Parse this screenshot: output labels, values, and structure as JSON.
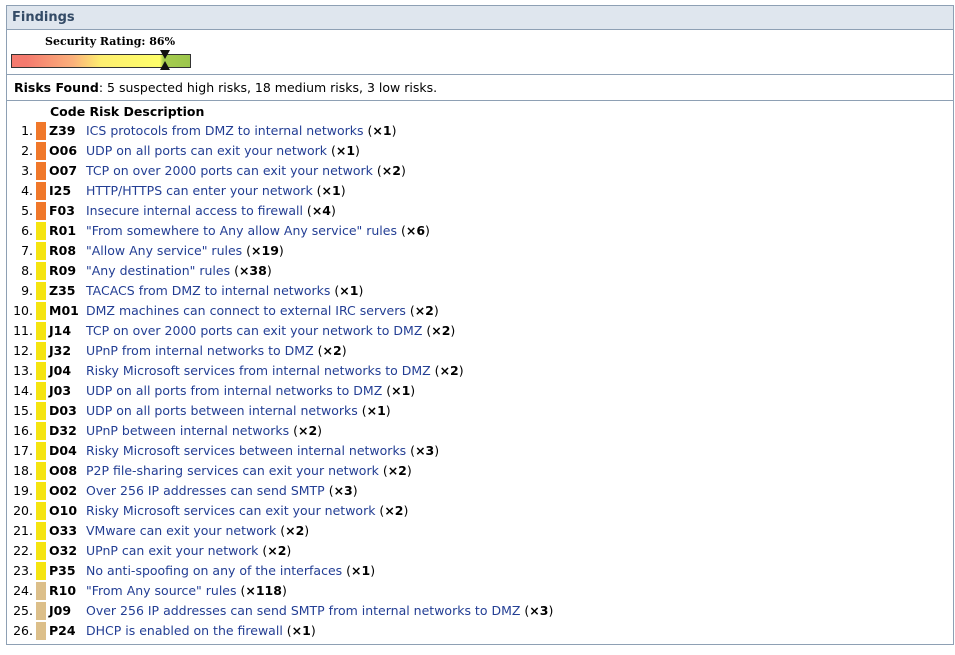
{
  "header": {
    "title": "Findings"
  },
  "rating": {
    "label": "Security Rating: 86%",
    "value_percent": 86
  },
  "summary": {
    "label": "Risks Found",
    "text": ": 5 suspected high risks, 18 medium risks, 3 low risks."
  },
  "table": {
    "header": "Code Risk Description"
  },
  "colors": {
    "high": "#f0782a",
    "medium": "#f5e410",
    "low": "#dcbf8a",
    "link": "#233e94"
  },
  "risks": [
    {
      "num": "1.",
      "code": "Z39",
      "desc": "ICS protocols from DMZ to internal networks",
      "count": "×1",
      "severity": "high"
    },
    {
      "num": "2.",
      "code": "O06",
      "desc": "UDP on all ports can exit your network",
      "count": "×1",
      "severity": "high"
    },
    {
      "num": "3.",
      "code": "O07",
      "desc": "TCP on over 2000 ports can exit your network",
      "count": "×2",
      "severity": "high"
    },
    {
      "num": "4.",
      "code": "I25",
      "desc": "HTTP/HTTPS can enter your network",
      "count": "×1",
      "severity": "high"
    },
    {
      "num": "5.",
      "code": "F03",
      "desc": "Insecure internal access to firewall",
      "count": "×4",
      "severity": "high"
    },
    {
      "num": "6.",
      "code": "R01",
      "desc": "\"From somewhere to Any allow Any service\" rules",
      "count": "×6",
      "severity": "medium"
    },
    {
      "num": "7.",
      "code": "R08",
      "desc": "\"Allow Any service\" rules",
      "count": "×19",
      "severity": "medium"
    },
    {
      "num": "8.",
      "code": "R09",
      "desc": "\"Any destination\" rules",
      "count": "×38",
      "severity": "medium"
    },
    {
      "num": "9.",
      "code": "Z35",
      "desc": "TACACS from DMZ to internal networks",
      "count": "×1",
      "severity": "medium"
    },
    {
      "num": "10.",
      "code": "M01",
      "desc": "DMZ machines can connect to external IRC servers",
      "count": "×2",
      "severity": "medium"
    },
    {
      "num": "11.",
      "code": "J14",
      "desc": "TCP on over 2000 ports can exit your network to DMZ",
      "count": "×2",
      "severity": "medium"
    },
    {
      "num": "12.",
      "code": "J32",
      "desc": "UPnP from internal networks to DMZ",
      "count": "×2",
      "severity": "medium"
    },
    {
      "num": "13.",
      "code": "J04",
      "desc": "Risky Microsoft services from internal networks to DMZ",
      "count": "×2",
      "severity": "medium"
    },
    {
      "num": "14.",
      "code": "J03",
      "desc": "UDP on all ports from internal networks to DMZ",
      "count": "×1",
      "severity": "medium"
    },
    {
      "num": "15.",
      "code": "D03",
      "desc": "UDP on all ports between internal networks",
      "count": "×1",
      "severity": "medium"
    },
    {
      "num": "16.",
      "code": "D32",
      "desc": "UPnP between internal networks",
      "count": "×2",
      "severity": "medium"
    },
    {
      "num": "17.",
      "code": "D04",
      "desc": "Risky Microsoft services between internal networks",
      "count": "×3",
      "severity": "medium"
    },
    {
      "num": "18.",
      "code": "O08",
      "desc": "P2P file-sharing services can exit your network",
      "count": "×2",
      "severity": "medium"
    },
    {
      "num": "19.",
      "code": "O02",
      "desc": "Over 256 IP addresses can send SMTP",
      "count": "×3",
      "severity": "medium"
    },
    {
      "num": "20.",
      "code": "O10",
      "desc": "Risky Microsoft services can exit your network",
      "count": "×2",
      "severity": "medium"
    },
    {
      "num": "21.",
      "code": "O33",
      "desc": "VMware can exit your network",
      "count": "×2",
      "severity": "medium"
    },
    {
      "num": "22.",
      "code": "O32",
      "desc": "UPnP can exit your network",
      "count": "×2",
      "severity": "medium"
    },
    {
      "num": "23.",
      "code": "P35",
      "desc": "No anti-spoofing on any of the interfaces",
      "count": "×1",
      "severity": "medium"
    },
    {
      "num": "24.",
      "code": "R10",
      "desc": "\"From Any source\" rules",
      "count": "×118",
      "severity": "low"
    },
    {
      "num": "25.",
      "code": "J09",
      "desc": "Over 256 IP addresses can send SMTP from internal networks to DMZ",
      "count": "×3",
      "severity": "low"
    },
    {
      "num": "26.",
      "code": "P24",
      "desc": "DHCP is enabled on the firewall",
      "count": "×1",
      "severity": "low"
    }
  ]
}
